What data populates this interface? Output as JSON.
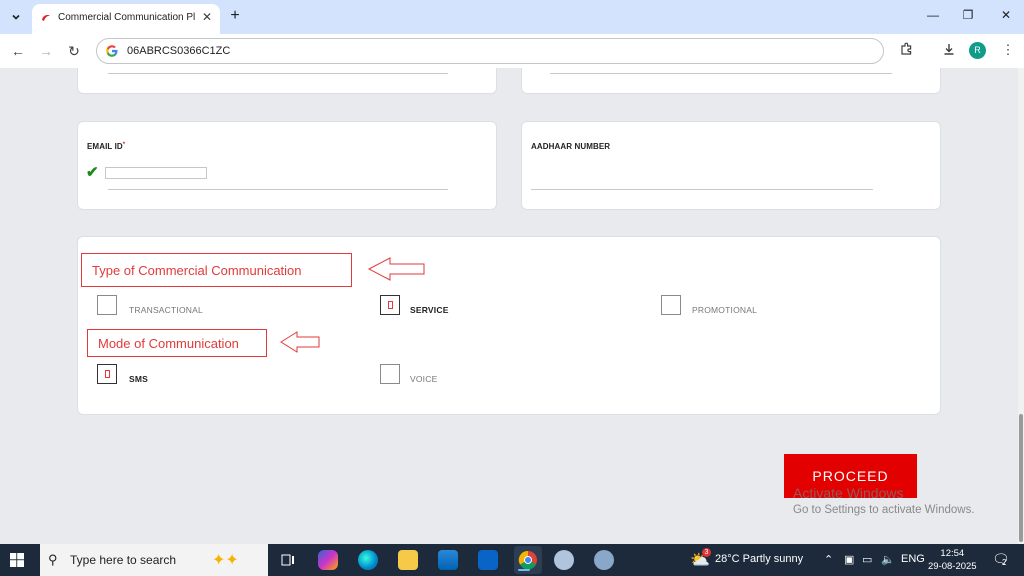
{
  "browser": {
    "tab_title": "Commercial Communication Pl",
    "address": "06ABRCS0366C1ZC",
    "avatar_initial": "R",
    "icons": {
      "tab_menu": "chevron-down-icon",
      "close": "close-icon",
      "new_tab": "plus-icon",
      "back": "arrow-left-icon",
      "forward": "arrow-right-icon",
      "reload": "reload-icon",
      "extensions": "puzzle-icon",
      "download": "download-icon",
      "menu": "kebab-menu-icon"
    }
  },
  "form": {
    "email_label": "EMAIL ID",
    "email_required_mark": "*",
    "aadhaar_label": "AADHAAR NUMBER",
    "type_heading": "Type of Commercial Communication",
    "mode_heading": "Mode of Communication",
    "type_options": [
      {
        "label": "TRANSACTIONAL",
        "checked": false
      },
      {
        "label": "SERVICE",
        "checked": true
      },
      {
        "label": "PROMOTIONAL",
        "checked": false
      }
    ],
    "mode_options": [
      {
        "label": "SMS",
        "checked": true
      },
      {
        "label": "VOICE",
        "checked": false
      }
    ],
    "proceed_label": "PROCEED"
  },
  "watermark": {
    "line1": "Activate Windows",
    "line2": "Go to Settings to activate Windows."
  },
  "taskbar": {
    "search_placeholder": "Type here to search",
    "weather": "28°C  Partly sunny",
    "weather_badge": "3",
    "language": "ENG",
    "time": "12:54",
    "date": "29-08-2025",
    "notification_count": "2"
  },
  "colors": {
    "accent_red": "#e30000",
    "annotation_red": "#e23a3a",
    "check_green": "#1a8a1a",
    "taskbar_bg": "#1c2a3b"
  }
}
